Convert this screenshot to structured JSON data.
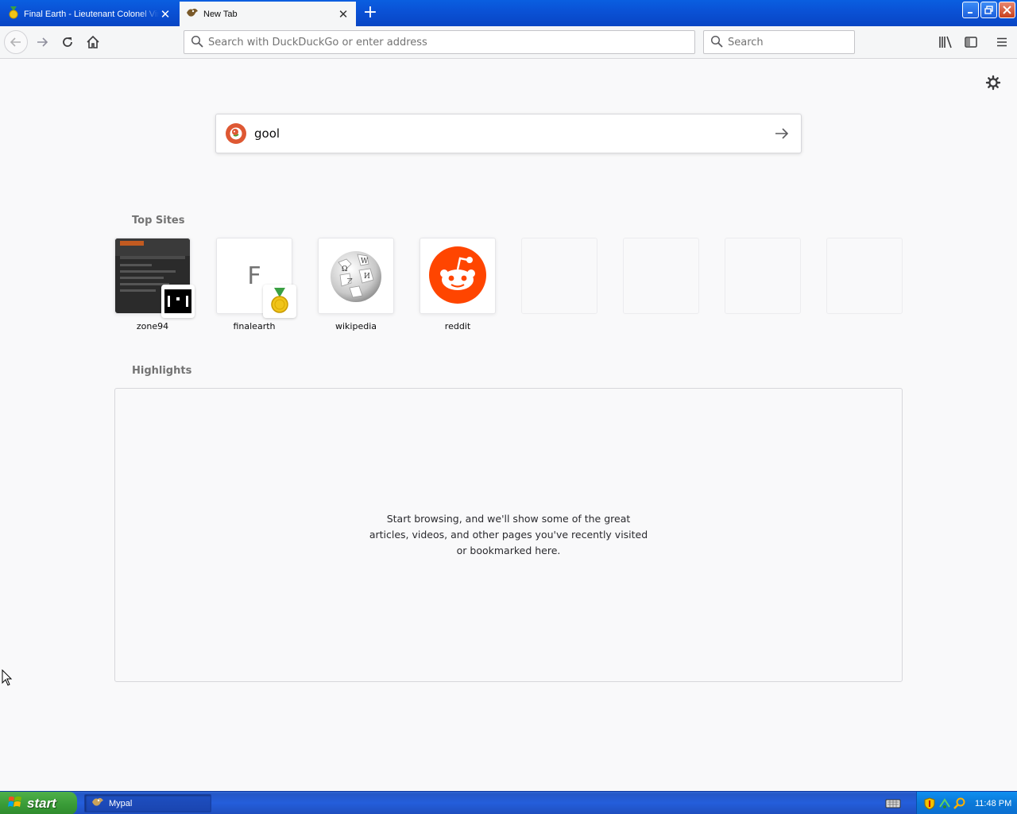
{
  "browser": {
    "tabs": [
      {
        "title": "Final Earth - Lieutenant Colonel Vin",
        "active": false,
        "icon": "medal-icon"
      },
      {
        "title": "New Tab",
        "active": true,
        "icon": "browser-tab-icon"
      }
    ],
    "new_tab_symbol": "+",
    "close_symbol": "✕",
    "url_placeholder": "Search with DuckDuckGo or enter address",
    "search_placeholder": "Search"
  },
  "newtab": {
    "search_value": "gool",
    "top_sites_title": "Top Sites",
    "top_sites": [
      {
        "label": "zone94",
        "kind": "screenshot"
      },
      {
        "label": "finalearth",
        "kind": "letter",
        "letter": "F"
      },
      {
        "label": "wikipedia",
        "kind": "wikipedia"
      },
      {
        "label": "reddit",
        "kind": "reddit"
      },
      {
        "label": "",
        "kind": "empty"
      },
      {
        "label": "",
        "kind": "empty"
      },
      {
        "label": "",
        "kind": "empty"
      },
      {
        "label": "",
        "kind": "empty"
      }
    ],
    "highlights_title": "Highlights",
    "highlights_empty_message": "Start browsing, and we'll show some of the great articles, videos, and other pages you've recently visited or bookmarked here."
  },
  "taskbar": {
    "start_label": "start",
    "task_label": "Mypal",
    "clock": "11:48 PM"
  },
  "colors": {
    "reddit": "#ff4500",
    "duckduckgo": "#de5833",
    "xp_blue": "#245edb",
    "xp_green": "#389a36"
  }
}
